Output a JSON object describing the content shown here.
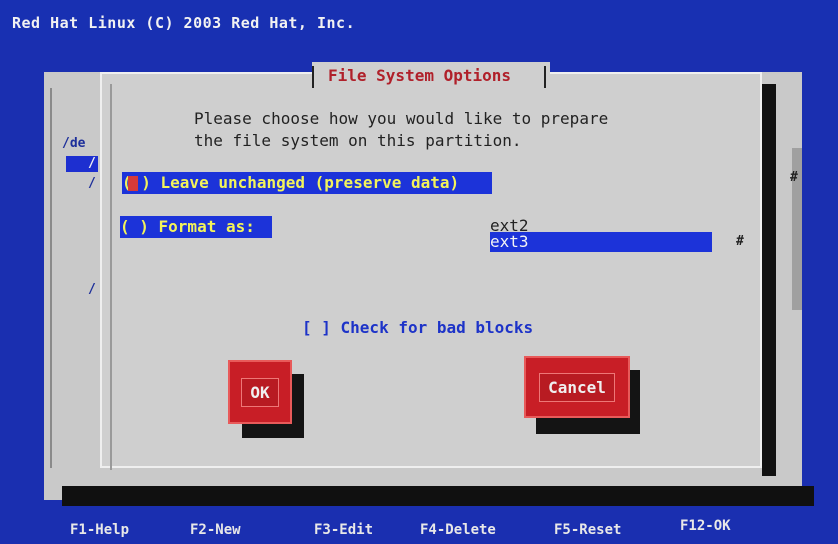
{
  "header": {
    "title": "Red Hat Linux (C) 2003 Red Hat, Inc."
  },
  "background_window": {
    "left_labels": [
      "/de",
      "/",
      "/",
      "/"
    ]
  },
  "dialog": {
    "title": "File System Options",
    "prompt_line1": "Please choose how you would like to prepare",
    "prompt_line2": "the file system on this partition.",
    "options": {
      "leave_unchanged": "( ) Leave unchanged (preserve data)",
      "format_as": "( ) Format as:"
    },
    "filesystems": [
      "ext2",
      "ext3"
    ],
    "selected_filesystem": "ext3",
    "list_scroll_marker": "#",
    "check_bad_blocks": "[ ] Check for bad blocks",
    "buttons": {
      "ok": "OK",
      "cancel": "Cancel"
    }
  },
  "scrollbar": {
    "marker": "#"
  },
  "footer": {
    "keys": [
      "F1-Help",
      "F2-New",
      "F3-Edit",
      "F4-Delete",
      "F5-Reset",
      "F12-OK"
    ]
  },
  "colors": {
    "screen_bg": "#1a2fb0",
    "dialog_bg": "#cfcfcf",
    "title_red": "#b0202a",
    "selection_blue": "#1c33d9",
    "selection_text": "#f3f35a",
    "button_red": "#c81e26"
  }
}
